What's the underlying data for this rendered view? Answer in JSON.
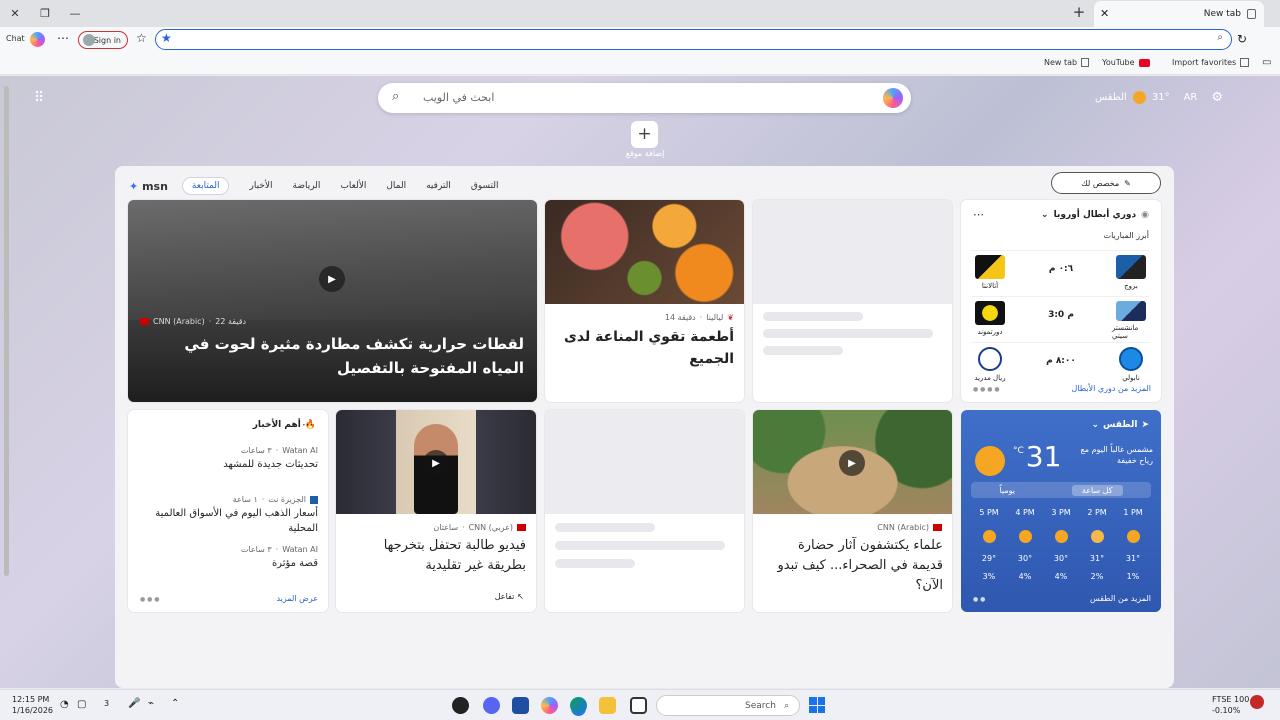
{
  "browser": {
    "tab_title": "New tab",
    "sign_in": "Sign in",
    "chat": "Chat",
    "favorites": {
      "import": "Import favorites",
      "youtube": "YouTube",
      "newtab": "New tab"
    }
  },
  "header": {
    "search_placeholder": "ابحث في الويب",
    "location": "AR",
    "temperature": "31°",
    "weather_label": "الطقس",
    "add_shortcut": "إضافة موقع"
  },
  "feed": {
    "nav": [
      "المتابعة",
      "الأخبار",
      "الرياضة",
      "الألعاب",
      "المال",
      "الترفيه",
      "التسوق"
    ],
    "active_tab": "المتابعة",
    "personalize": "مخصص لك",
    "brand": "msn"
  },
  "cards": {
    "hero": {
      "source": "CNN (Arabic)",
      "time": "22 دقيقة",
      "headline": "لقطات حرارية تكشف مطاردة مثيرة لحوت في المياه المفتوحة بالتفصيل"
    },
    "food": {
      "source": "ليالينا",
      "time": "14 دقيقة",
      "headline": "أطعمة تقوي المناعة لدى الجميع"
    },
    "sports": {
      "title": "دوري أبطال أوروبا",
      "subtitle": "أبرز المباريات",
      "matches": [
        {
          "home": "بروج",
          "away": "أتالانتا",
          "score": "٠:٦ م",
          "kind": "upcoming"
        },
        {
          "home": "مانشستر سيتي",
          "away": "دورتموند",
          "score": "3:0 م",
          "kind": "final"
        },
        {
          "home": "نابولي",
          "away": "ريال مدريد",
          "score": "٨:٠٠ م",
          "kind": "upcoming"
        }
      ],
      "link": "المزيد من دوري الأبطال"
    },
    "trending": {
      "title": "أهم الأخبار",
      "items": [
        {
          "source": "Watan AI",
          "time": "٣ ساعات",
          "headline": "تحديثات جديدة للمشهد"
        },
        {
          "source": "الجزيرة نت",
          "time": "١ ساعة",
          "headline": "أسعار الذهب اليوم في الأسواق العالمية المحلية"
        },
        {
          "source": "Watan AI",
          "time": "٣ ساعات",
          "headline": "قصة مؤثرة"
        }
      ],
      "link": "عرض المزيد"
    },
    "graduate": {
      "source": "CNN (عربي)",
      "time": "ساعتان",
      "headline": "فيديو طالبة تحتفل بتخرجها بطريقة غير تقليدية",
      "reactions": "تفاعل"
    },
    "desert": {
      "source": "CNN (Arabic)",
      "headline": "علماء يكتشفون آثار حضارة قديمة في الصحراء... كيف تبدو الآن؟"
    },
    "weather": {
      "title": "الطقس",
      "temp": "31",
      "unit": "°C",
      "description": "مشمس غالباً اليوم مع رياح خفيفة",
      "tabs": [
        "كل ساعة",
        "يومياً"
      ],
      "hours": [
        "5 PM",
        "4 PM",
        "3 PM",
        "2 PM",
        "1 PM"
      ],
      "temps": [
        "29°",
        "30°",
        "30°",
        "31°",
        "31°"
      ],
      "precip": [
        "3%",
        "4%",
        "4%",
        "2%",
        "1%"
      ],
      "link": "المزيد من الطقس"
    }
  },
  "taskbar": {
    "search": "Search",
    "time": "12:15 PM",
    "date": "1/16/2026",
    "ticker_name": "FTSE 100",
    "ticker_value": "-0.10%",
    "count": "3"
  }
}
